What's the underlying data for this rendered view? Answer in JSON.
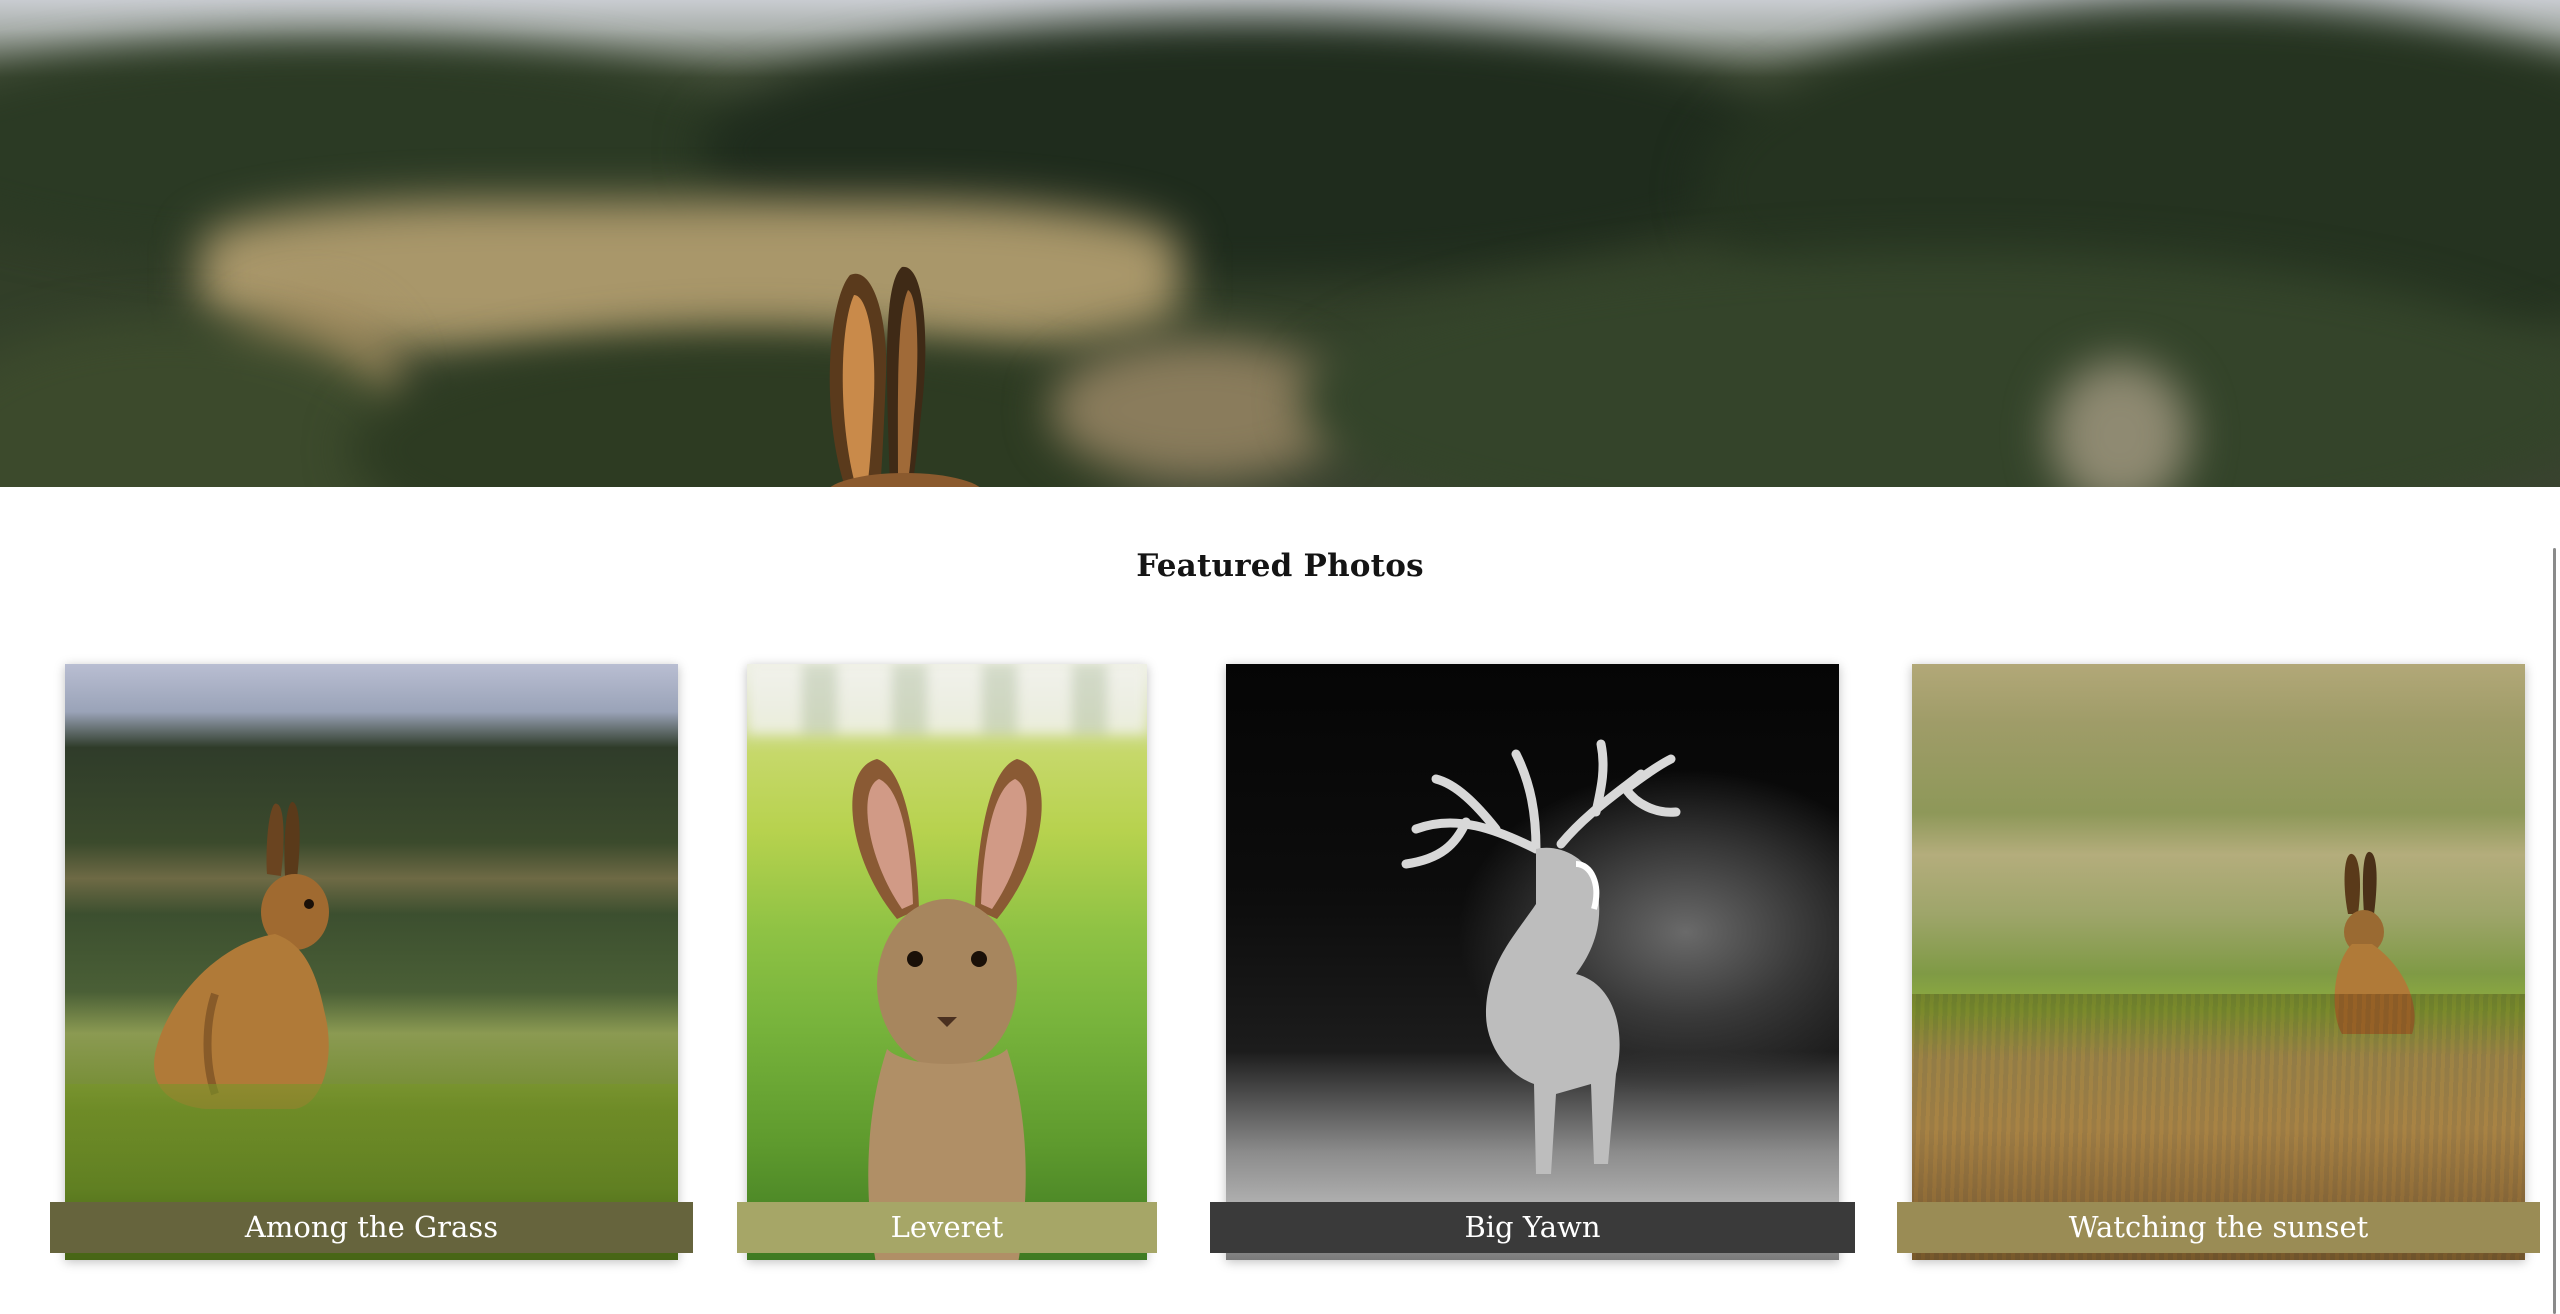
{
  "section_title": "Featured Photos",
  "cards": [
    {
      "title": "Among the Grass",
      "caption_color": "#66643d",
      "photo_icon": "hare-icon"
    },
    {
      "title": "Leveret",
      "caption_color": "#a6a667",
      "photo_icon": "hare-icon"
    },
    {
      "title": "Big Yawn",
      "caption_color": "#3a3a3a",
      "photo_icon": "stag-icon"
    },
    {
      "title": "Watching the sunset",
      "caption_color": "#9a8c55",
      "photo_icon": "hare-icon"
    }
  ]
}
